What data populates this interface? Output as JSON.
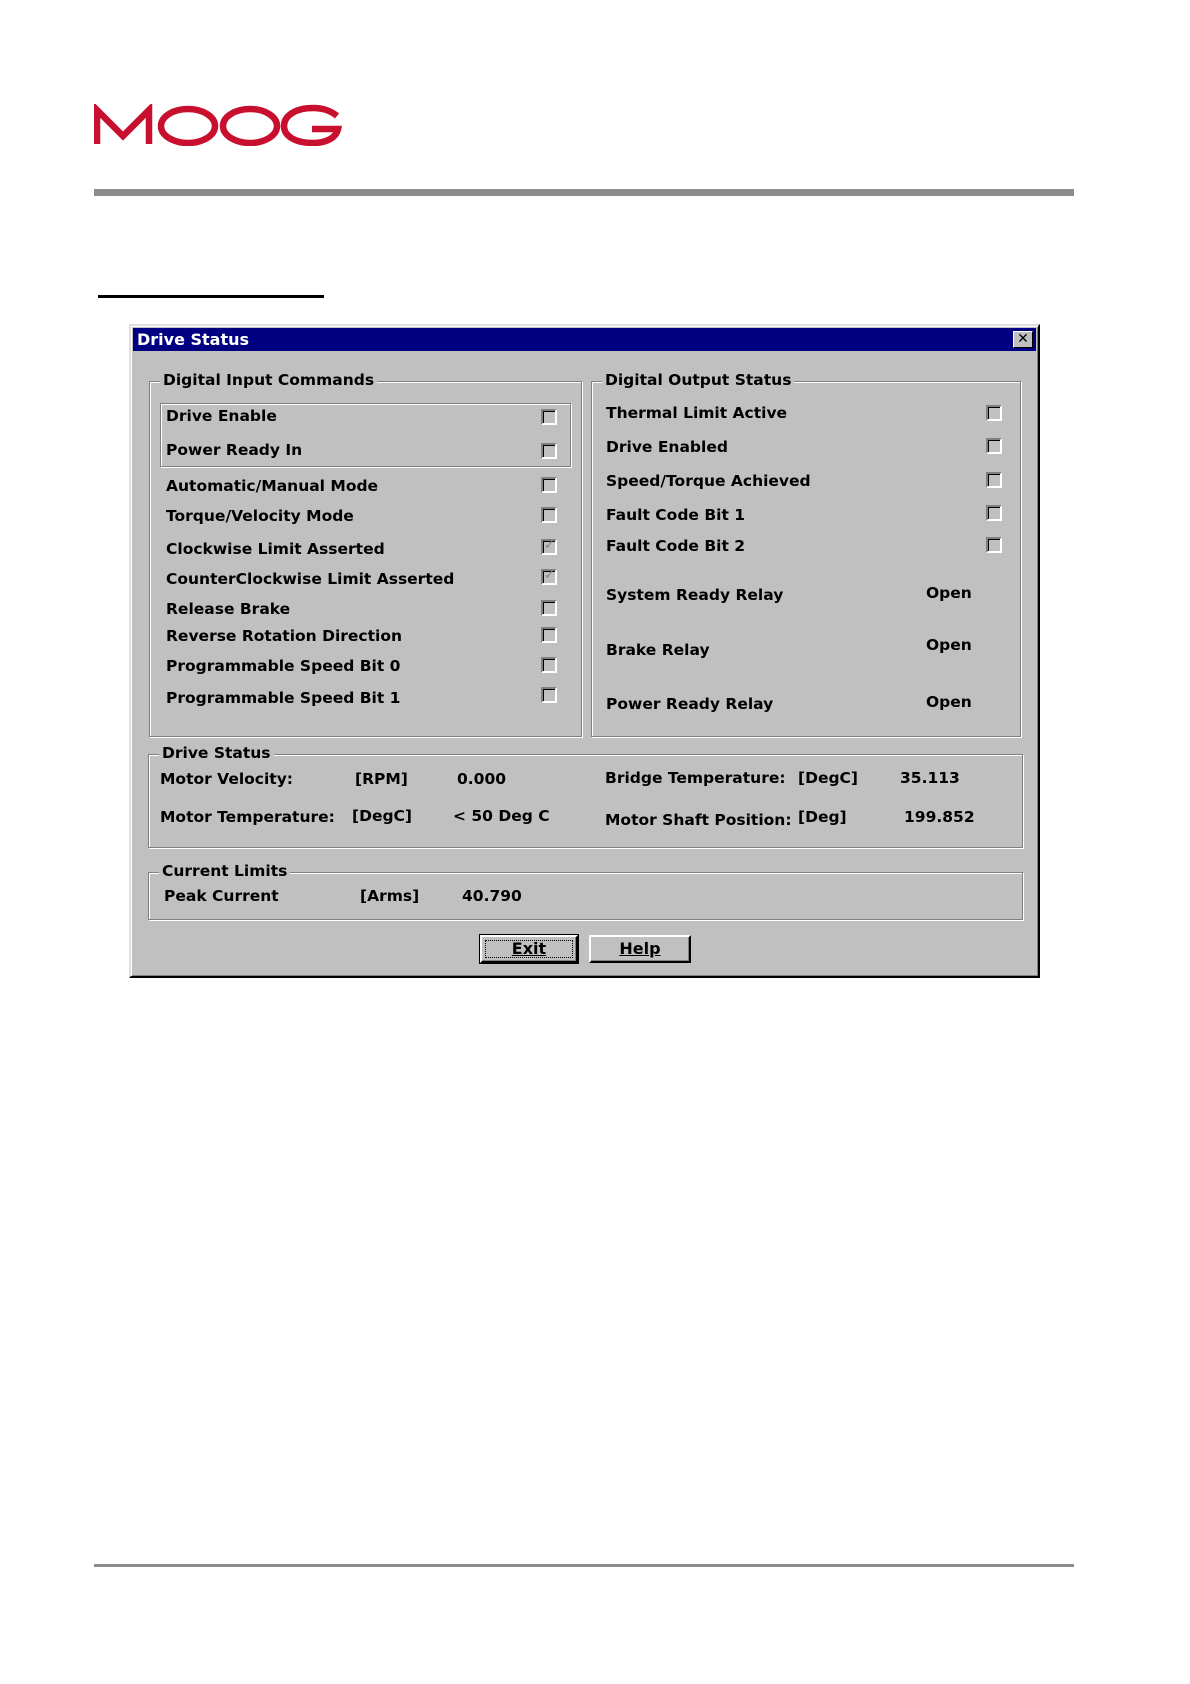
{
  "logo": {
    "text": "MOOG",
    "color": "#c8102e"
  },
  "window": {
    "title": "Drive Status",
    "close_icon": "close-icon"
  },
  "digital_inputs": {
    "legend": "Digital Input Commands",
    "items": [
      {
        "label": "Drive Enable",
        "checked": false
      },
      {
        "label": "Power Ready In",
        "checked": false
      },
      {
        "label": "Automatic/Manual Mode",
        "checked": false
      },
      {
        "label": "Torque/Velocity Mode",
        "checked": false
      },
      {
        "label": "Clockwise Limit Asserted",
        "checked": true
      },
      {
        "label": "CounterClockwise Limit Asserted",
        "checked": true
      },
      {
        "label": "Release Brake",
        "checked": false
      },
      {
        "label": "Reverse Rotation Direction",
        "checked": false
      },
      {
        "label": "Programmable Speed Bit 0",
        "checked": false
      },
      {
        "label": "Programmable Speed Bit 1",
        "checked": false
      }
    ]
  },
  "digital_outputs": {
    "legend": "Digital Output Status",
    "items": [
      {
        "label": "Thermal Limit Active",
        "checked": false
      },
      {
        "label": "Drive Enabled",
        "checked": false
      },
      {
        "label": "Speed/Torque Achieved",
        "checked": false
      },
      {
        "label": "Fault Code Bit 1",
        "checked": false
      },
      {
        "label": "Fault Code Bit 2",
        "checked": false
      }
    ],
    "relays": [
      {
        "label": "System Ready Relay",
        "value": "Open"
      },
      {
        "label": "Brake Relay",
        "value": "Open"
      },
      {
        "label": "Power Ready Relay",
        "value": "Open"
      }
    ]
  },
  "drive_status": {
    "legend": "Drive Status",
    "motor_velocity": {
      "label": "Motor Velocity:",
      "unit": "[RPM]",
      "value": "0.000"
    },
    "motor_temperature": {
      "label": "Motor Temperature:",
      "unit": "[DegC]",
      "value": "< 50 Deg C"
    },
    "bridge_temperature": {
      "label": "Bridge Temperature:",
      "unit": "[DegC]",
      "value": "35.113"
    },
    "motor_shaft_position": {
      "label": "Motor Shaft Position:",
      "unit": "[Deg]",
      "value": "199.852"
    }
  },
  "current_limits": {
    "legend": "Current Limits",
    "peak_current": {
      "label": "Peak Current",
      "unit": "[Arms]",
      "value": "40.790"
    }
  },
  "buttons": {
    "exit": "Exit",
    "help": "Help"
  }
}
